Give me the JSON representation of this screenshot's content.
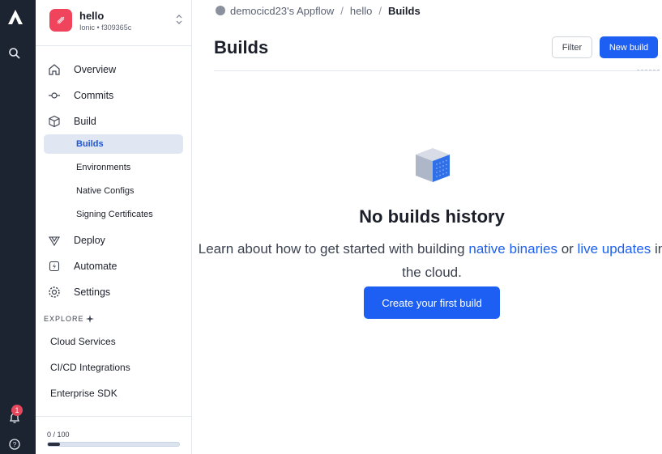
{
  "rail": {
    "icons": [
      "appflow-logo",
      "search-icon",
      "bell-icon",
      "help-icon"
    ],
    "notification_count": "1"
  },
  "app": {
    "name": "hello",
    "subtitle": "Ionic • f309365c",
    "icon_color": "#f0445c"
  },
  "nav": {
    "overview": "Overview",
    "commits": "Commits",
    "build": "Build",
    "build_children": [
      "Builds",
      "Environments",
      "Native Configs",
      "Signing Certificates"
    ],
    "deploy": "Deploy",
    "automate": "Automate",
    "settings": "Settings"
  },
  "explore": {
    "heading": "EXPLORE",
    "items": [
      "Cloud Services",
      "CI/CD Integrations",
      "Enterprise SDK"
    ]
  },
  "usage": {
    "text": "0 / 100",
    "fraction": 0.09
  },
  "breadcrumb": {
    "org": "democicd23's Appflow",
    "app": "hello",
    "current": "Builds"
  },
  "page": {
    "title": "Builds",
    "filter_label": "Filter",
    "new_build_label": "New build"
  },
  "empty_state": {
    "title": "No builds history",
    "text_before": "Learn about how to get started with building ",
    "link1": "native binaries",
    "text_mid": " or ",
    "link2": "live updates",
    "text_after": " in the cloud.",
    "button_label": "Create your first build"
  },
  "colors": {
    "accent": "#1d5ff2",
    "rail_bg": "#1c2331",
    "badge": "#e5485d"
  }
}
